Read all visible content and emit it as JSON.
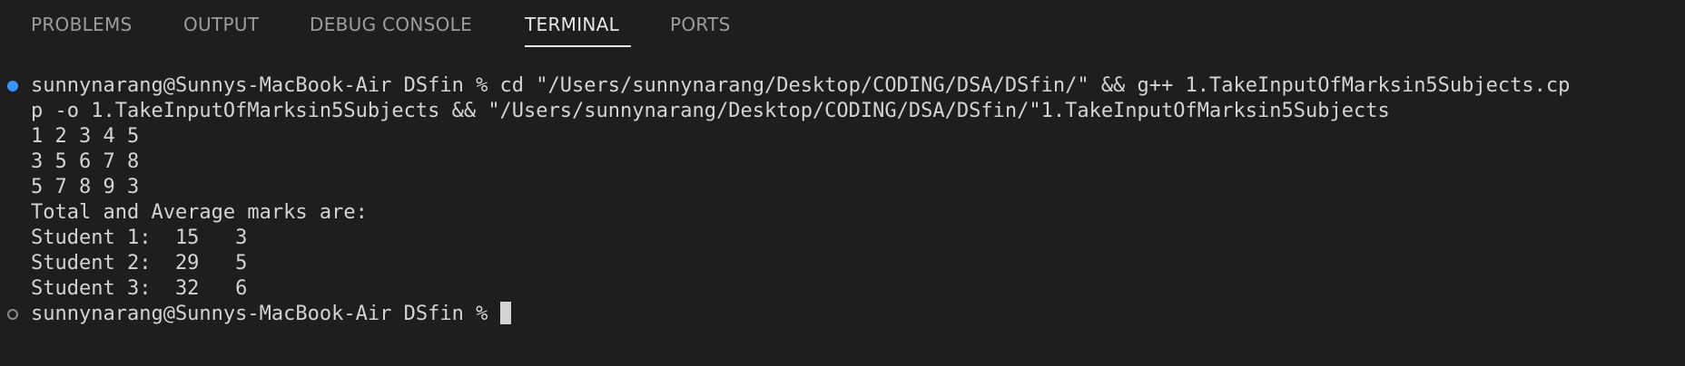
{
  "panel": {
    "tabs": [
      {
        "label": "PROBLEMS",
        "active": false
      },
      {
        "label": "OUTPUT",
        "active": false
      },
      {
        "label": "DEBUG CONSOLE",
        "active": false
      },
      {
        "label": "TERMINAL",
        "active": true
      },
      {
        "label": "PORTS",
        "active": false
      }
    ]
  },
  "terminal": {
    "lines": [
      "sunnynarang@Sunnys-MacBook-Air DSfin % cd \"/Users/sunnynarang/Desktop/CODING/DSA/DSfin/\" && g++ 1.TakeInputOfMarksin5Subjects.cp",
      "p -o 1.TakeInputOfMarksin5Subjects && \"/Users/sunnynarang/Desktop/CODING/DSA/DSfin/\"1.TakeInputOfMarksin5Subjects",
      "1 2 3 4 5",
      "3 5 6 7 8",
      "5 7 8 9 3",
      "Total and Average marks are:",
      "Student 1:  15   3",
      "Student 2:  29   5",
      "Student 3:  32   6"
    ],
    "prompt": "sunnynarang@Sunnys-MacBook-Air DSfin %",
    "colors": {
      "background": "#1e1e1e",
      "text": "#d4d4d4",
      "success_dot": "#3794ff",
      "idle_dot": "#8a8a8a"
    }
  }
}
